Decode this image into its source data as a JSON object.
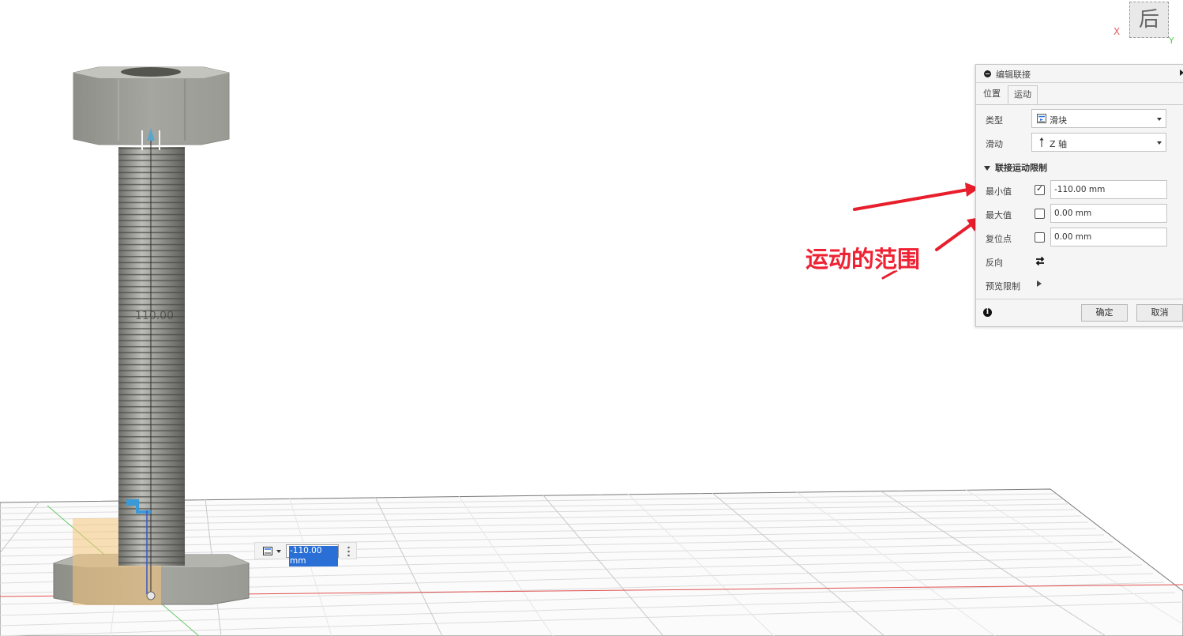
{
  "view_cube": {
    "face_label": "后",
    "axis_x": "X",
    "axis_y": "Y"
  },
  "panel": {
    "title": "编辑联接",
    "tabs": [
      "位置",
      "运动"
    ],
    "active_tab": "运动",
    "type_label": "类型",
    "type_value": "滑块",
    "slide_label": "滑动",
    "slide_value": "Z 轴",
    "limits_section": "联接运动限制",
    "min_label": "最小值",
    "min_checked": true,
    "min_value": "-110.00 mm",
    "max_label": "最大值",
    "max_checked": false,
    "max_value": "0.00 mm",
    "rest_label": "复位点",
    "rest_checked": false,
    "rest_value": "0.00 mm",
    "flip_label": "反向",
    "preview_label": "预览限制",
    "ok_label": "确定",
    "cancel_label": "取消"
  },
  "annotation": {
    "text": "运动的范围",
    "color": "#ee2233"
  },
  "viewport": {
    "dimension_label": "110.00",
    "manipulator_value": "-110.00 mm"
  },
  "colors": {
    "grid_line": "#c8c8c8",
    "axis_red": "#e05050",
    "axis_green": "#6bc86b",
    "selection": "#2a6fd6"
  }
}
